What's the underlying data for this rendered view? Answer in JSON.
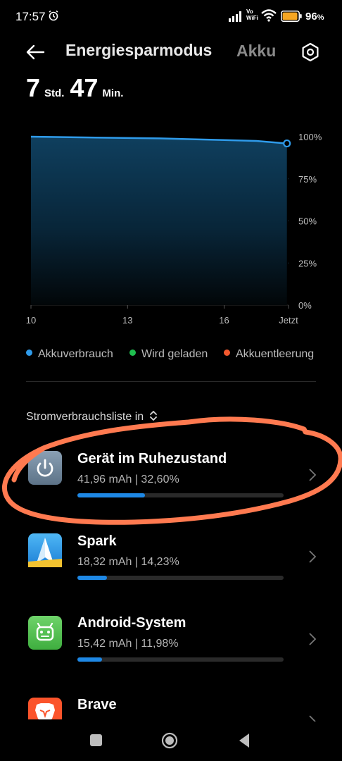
{
  "status_bar": {
    "time": "17:57",
    "network_label": "Vo\nWiFi",
    "battery_percent": "96",
    "battery_suffix": "%",
    "battery_level": 0.96,
    "battery_color": "#f5a623"
  },
  "header": {
    "title": "Energiesparmodus",
    "second_tab": "Akku",
    "icons": [
      "back-arrow-icon",
      "gear-icon"
    ]
  },
  "remaining": {
    "hours": "7",
    "hours_unit": "Std.",
    "minutes": "47",
    "minutes_unit": "Min."
  },
  "chart_data": {
    "type": "area",
    "x_ticks": [
      "10",
      "13",
      "16",
      "Jetzt"
    ],
    "y_ticks": [
      "100%",
      "75%",
      "50%",
      "25%",
      "0%"
    ],
    "ylim": [
      0,
      100
    ],
    "x_range_hours": [
      10,
      18
    ],
    "series": [
      {
        "name": "Akkuverbrauch",
        "color": "#2f9bea",
        "x": [
          10,
          12,
          14,
          16,
          17,
          17.95
        ],
        "y": [
          100,
          99.5,
          99,
          98,
          97.5,
          96
        ]
      }
    ],
    "grid": true
  },
  "legend": [
    {
      "label": "Akkuverbrauch",
      "color": "#2f9bea"
    },
    {
      "label": "Wird geladen",
      "color": "#1fbe4f"
    },
    {
      "label": "Akkuentleerung",
      "color": "#f4592e"
    }
  ],
  "list": {
    "header": "Stromverbrauchsliste in",
    "items": [
      {
        "name": "Gerät im Ruhezustand",
        "detail": "41,96 mAh | 32,60%",
        "share": 0.326,
        "icon": "power-icon"
      },
      {
        "name": "Spark",
        "detail": "18,32 mAh | 14,23%",
        "share": 0.1423,
        "icon": "spark-app-icon"
      },
      {
        "name": "Android-System",
        "detail": "15,42 mAh | 11,98%",
        "share": 0.1198,
        "icon": "android-icon"
      },
      {
        "name": "Brave",
        "detail": "",
        "share": 0,
        "icon": "brave-icon"
      }
    ]
  },
  "annotation_color": "#ff7a50"
}
